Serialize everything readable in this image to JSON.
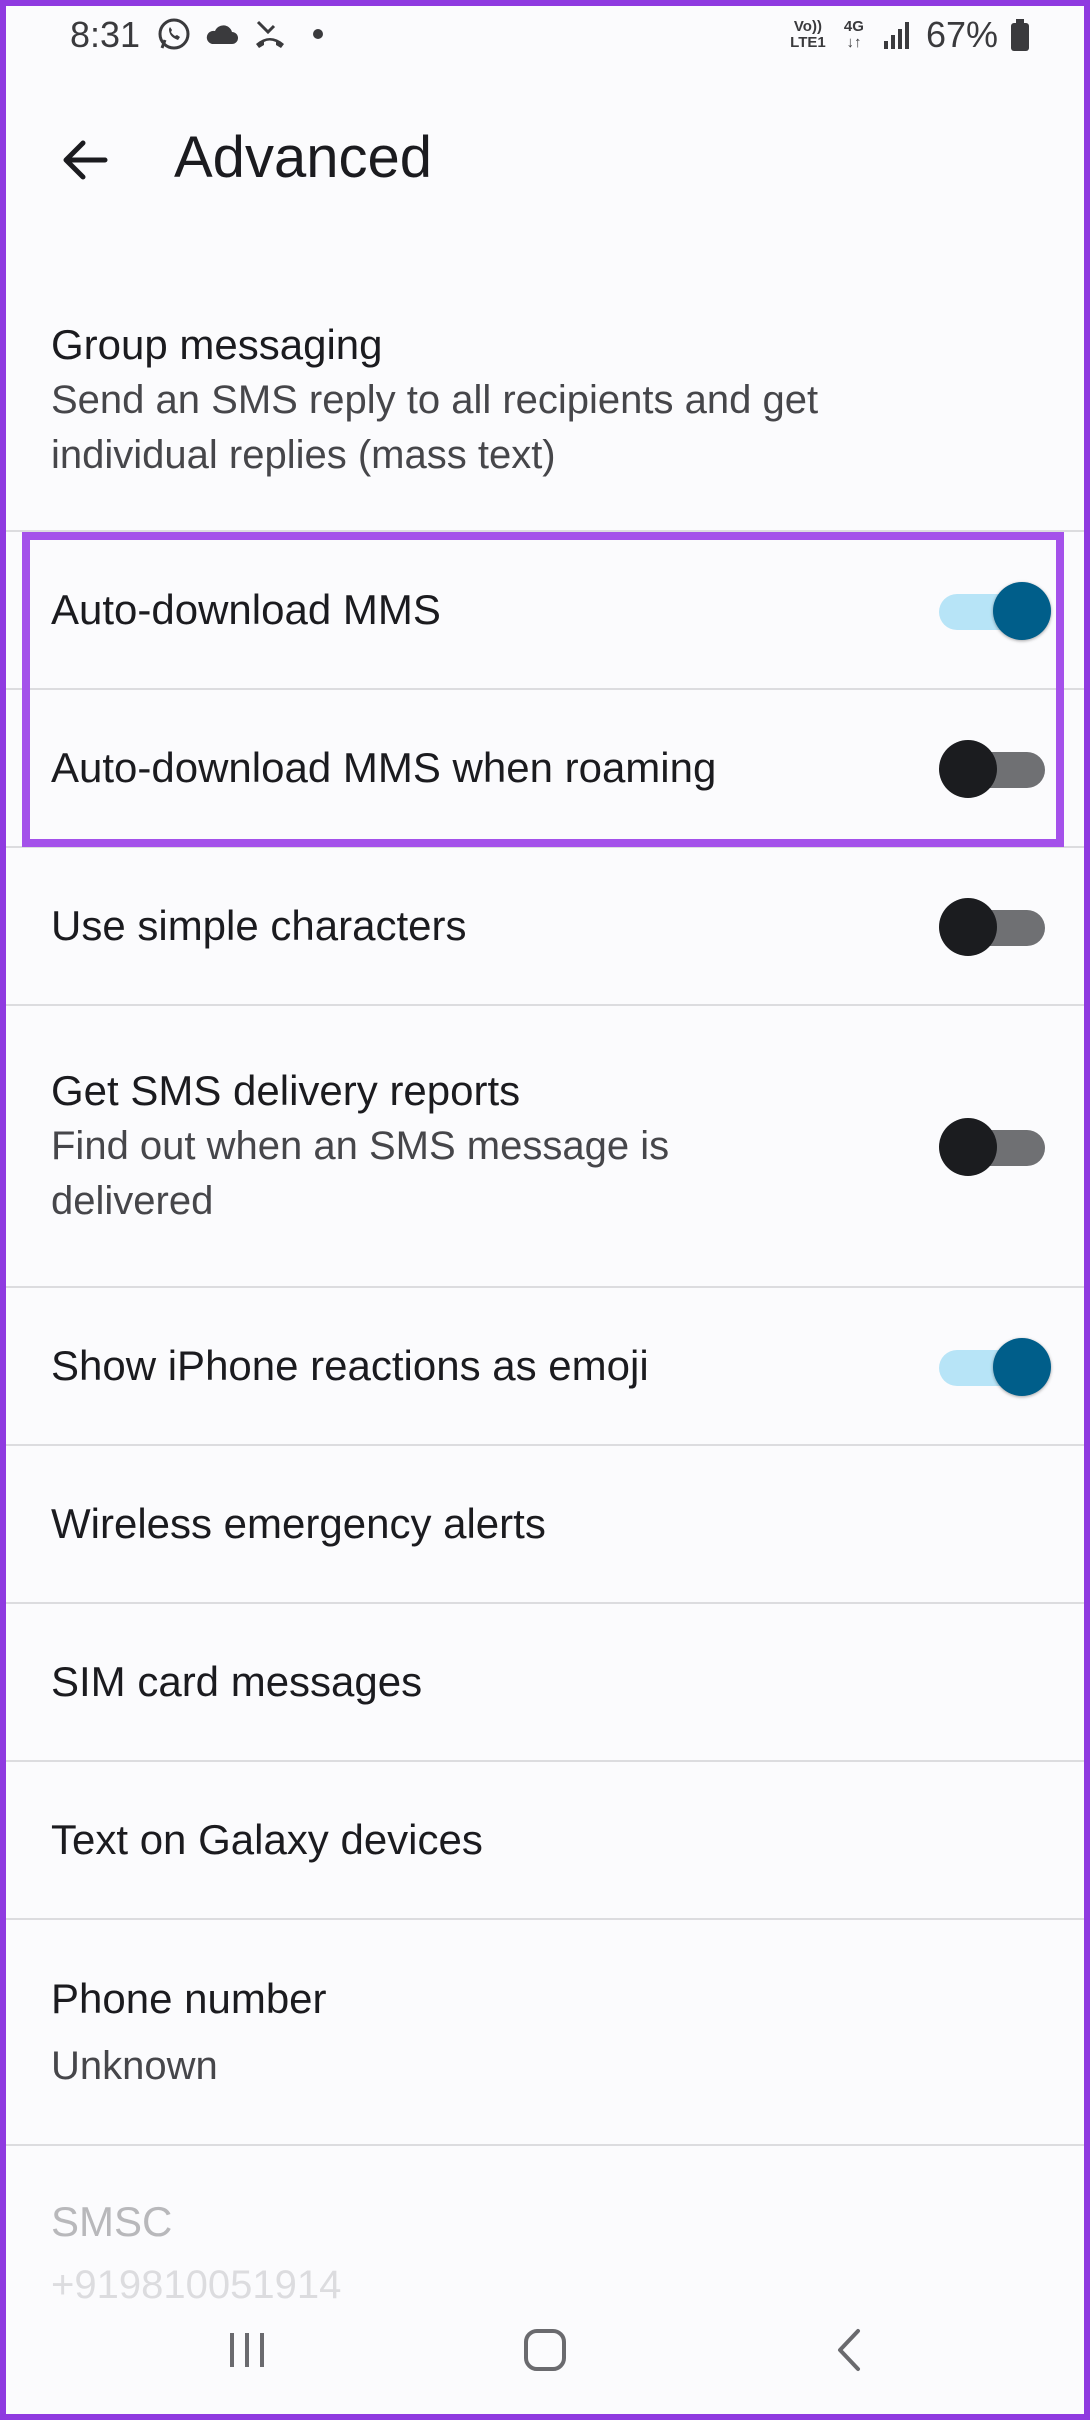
{
  "status_bar": {
    "time": "8:31",
    "battery_percent": "67%",
    "network_volte": "Vo)) LTE1",
    "network_type": "4G",
    "icons": [
      "whatsapp-icon",
      "cloud-icon",
      "missed-call-icon",
      "dot-icon",
      "volte-icon",
      "4g-icon",
      "signal-icon",
      "battery-icon"
    ]
  },
  "app_bar": {
    "back_icon": "back-arrow-icon",
    "title": "Advanced"
  },
  "settings": {
    "group_messaging": {
      "title": "Group messaging",
      "subtitle_line1": "Send an SMS reply to all recipients and get",
      "subtitle_line2": "individual replies (mass text)"
    },
    "auto_download_mms": {
      "title": "Auto-download MMS",
      "toggle": "on"
    },
    "auto_download_roaming": {
      "title": "Auto-download MMS when roaming",
      "toggle": "off"
    },
    "simple_characters": {
      "title": "Use simple characters",
      "toggle": "off"
    },
    "delivery_reports": {
      "title": "Get SMS delivery reports",
      "subtitle_line1": "Find out when an SMS message is",
      "subtitle_line2": "delivered",
      "toggle": "off"
    },
    "iphone_reactions": {
      "title": "Show iPhone reactions as emoji",
      "toggle": "on"
    },
    "emergency_alerts": {
      "title": "Wireless emergency alerts"
    },
    "sim_messages": {
      "title": "SIM card messages"
    },
    "galaxy_text": {
      "title": "Text on Galaxy devices"
    },
    "phone_number": {
      "title": "Phone number",
      "subtitle": "Unknown"
    },
    "smsc": {
      "title": "SMSC",
      "subtitle": "+919810051914"
    }
  },
  "colors": {
    "frame": "#8f3ae0",
    "highlight": "#a451ea",
    "toggle_on_thumb": "#005e8a",
    "toggle_on_track": "#b7e4f7",
    "toggle_off_thumb": "#1b1c1f",
    "toggle_off_track": "#6f7073"
  },
  "nav_bar": {
    "icons": [
      "recent-apps-icon",
      "home-icon",
      "back-icon"
    ]
  }
}
